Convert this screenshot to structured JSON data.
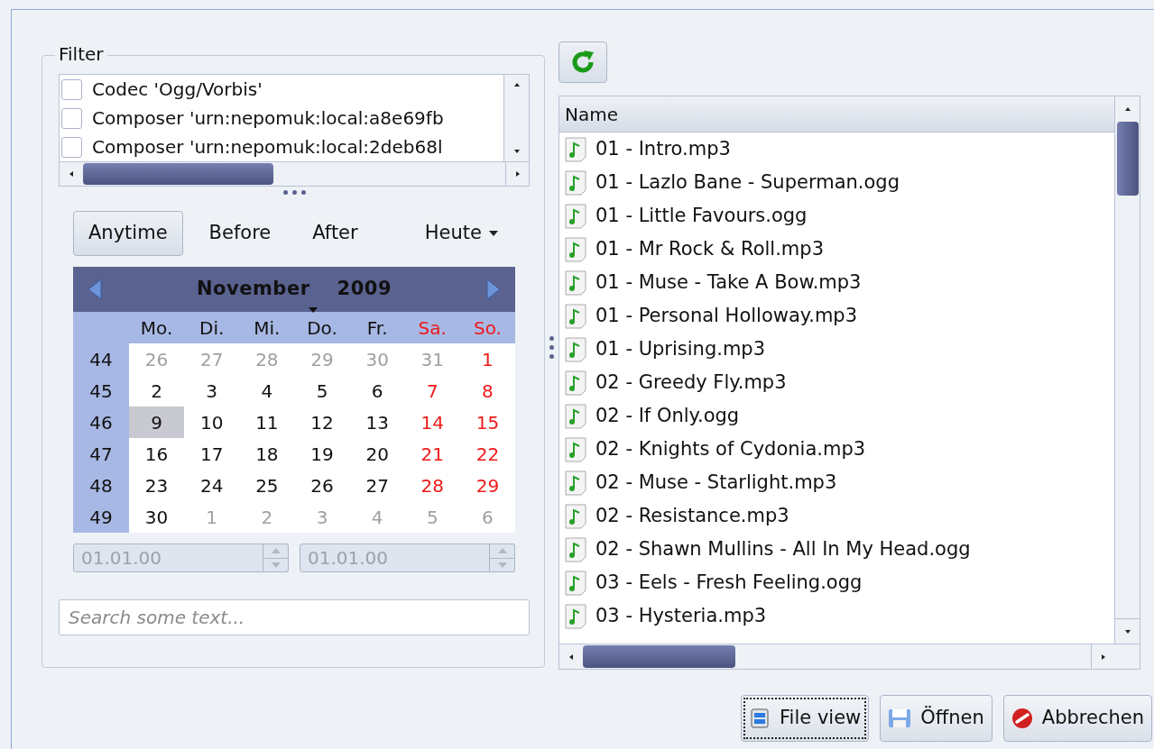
{
  "filter": {
    "title": "Filter",
    "items": [
      {
        "label": "Codec 'Ogg/Vorbis'",
        "checked": false
      },
      {
        "label": "Composer 'urn:nepomuk:local:a8e69fb",
        "checked": false
      },
      {
        "label": "Composer 'urn:nepomuk:local:2deb68l",
        "checked": false
      }
    ]
  },
  "periods": [
    {
      "label": "Anytime",
      "selected": true,
      "kind": "button"
    },
    {
      "label": "Before",
      "selected": false,
      "kind": "button"
    },
    {
      "label": "After",
      "selected": false,
      "kind": "button"
    },
    {
      "label": "Heute",
      "selected": false,
      "kind": "dropdown"
    }
  ],
  "calendar": {
    "month": "November",
    "year": "2009",
    "weekdays": [
      {
        "label": "Mo.",
        "kind": "normal"
      },
      {
        "label": "Di.",
        "kind": "normal"
      },
      {
        "label": "Mi.",
        "kind": "normal"
      },
      {
        "label": "Do.",
        "kind": "normal"
      },
      {
        "label": "Fr.",
        "kind": "normal"
      },
      {
        "label": "Sa.",
        "kind": "weekend"
      },
      {
        "label": "So.",
        "kind": "weekend"
      }
    ],
    "weeks": [
      {
        "number": "44",
        "days": [
          {
            "text": "26",
            "kind": "muted",
            "selected": false
          },
          {
            "text": "27",
            "kind": "muted",
            "selected": false
          },
          {
            "text": "28",
            "kind": "muted",
            "selected": false
          },
          {
            "text": "29",
            "kind": "muted",
            "selected": false
          },
          {
            "text": "30",
            "kind": "muted",
            "selected": false
          },
          {
            "text": "31",
            "kind": "muted",
            "selected": false
          },
          {
            "text": "1",
            "kind": "weekend",
            "selected": false
          }
        ]
      },
      {
        "number": "45",
        "days": [
          {
            "text": "2",
            "kind": "normal",
            "selected": false
          },
          {
            "text": "3",
            "kind": "normal",
            "selected": false
          },
          {
            "text": "4",
            "kind": "normal",
            "selected": false
          },
          {
            "text": "5",
            "kind": "normal",
            "selected": false
          },
          {
            "text": "6",
            "kind": "normal",
            "selected": false
          },
          {
            "text": "7",
            "kind": "weekend",
            "selected": false
          },
          {
            "text": "8",
            "kind": "weekend",
            "selected": false
          }
        ]
      },
      {
        "number": "46",
        "days": [
          {
            "text": "9",
            "kind": "normal",
            "selected": true
          },
          {
            "text": "10",
            "kind": "normal",
            "selected": false
          },
          {
            "text": "11",
            "kind": "normal",
            "selected": false
          },
          {
            "text": "12",
            "kind": "normal",
            "selected": false
          },
          {
            "text": "13",
            "kind": "normal",
            "selected": false
          },
          {
            "text": "14",
            "kind": "weekend",
            "selected": false
          },
          {
            "text": "15",
            "kind": "weekend",
            "selected": false
          }
        ]
      },
      {
        "number": "47",
        "days": [
          {
            "text": "16",
            "kind": "normal",
            "selected": false
          },
          {
            "text": "17",
            "kind": "normal",
            "selected": false
          },
          {
            "text": "18",
            "kind": "normal",
            "selected": false
          },
          {
            "text": "19",
            "kind": "normal",
            "selected": false
          },
          {
            "text": "20",
            "kind": "normal",
            "selected": false
          },
          {
            "text": "21",
            "kind": "weekend",
            "selected": false
          },
          {
            "text": "22",
            "kind": "weekend",
            "selected": false
          }
        ]
      },
      {
        "number": "48",
        "days": [
          {
            "text": "23",
            "kind": "normal",
            "selected": false
          },
          {
            "text": "24",
            "kind": "normal",
            "selected": false
          },
          {
            "text": "25",
            "kind": "normal",
            "selected": false
          },
          {
            "text": "26",
            "kind": "normal",
            "selected": false
          },
          {
            "text": "27",
            "kind": "normal",
            "selected": false
          },
          {
            "text": "28",
            "kind": "weekend",
            "selected": false
          },
          {
            "text": "29",
            "kind": "weekend",
            "selected": false
          }
        ]
      },
      {
        "number": "49",
        "days": [
          {
            "text": "30",
            "kind": "normal",
            "selected": false
          },
          {
            "text": "1",
            "kind": "muted",
            "selected": false
          },
          {
            "text": "2",
            "kind": "muted",
            "selected": false
          },
          {
            "text": "3",
            "kind": "muted",
            "selected": false
          },
          {
            "text": "4",
            "kind": "muted",
            "selected": false
          },
          {
            "text": "5",
            "kind": "muted",
            "selected": false
          },
          {
            "text": "6",
            "kind": "muted",
            "selected": false
          }
        ]
      }
    ]
  },
  "date_fields": [
    {
      "value": "01.01.00",
      "disabled": true
    },
    {
      "value": "01.01.00",
      "disabled": true
    }
  ],
  "search": {
    "placeholder": "Search some text..."
  },
  "files": {
    "column": "Name",
    "rows": [
      "01 - Intro.mp3",
      "01 - Lazlo Bane - Superman.ogg",
      "01 - Little Favours.ogg",
      "01 - Mr Rock & Roll.mp3",
      "01 - Muse - Take A Bow.mp3",
      "01 - Personal Holloway.mp3",
      "01 - Uprising.mp3",
      "02 - Greedy Fly.mp3",
      "02 - If Only.ogg",
      "02 - Knights of Cydonia.mp3",
      "02 - Muse - Starlight.mp3",
      "02 - Resistance.mp3",
      "02 - Shawn Mullins - All In My Head.ogg",
      "03 - Eels - Fresh Feeling.ogg",
      "03 - Hysteria.mp3"
    ]
  },
  "buttons": [
    {
      "label": "File view",
      "kind": "fileview",
      "focused": true
    },
    {
      "label": "Öffnen",
      "kind": "open",
      "focused": false
    },
    {
      "label": "Abbrechen",
      "kind": "cancel",
      "focused": false
    }
  ]
}
